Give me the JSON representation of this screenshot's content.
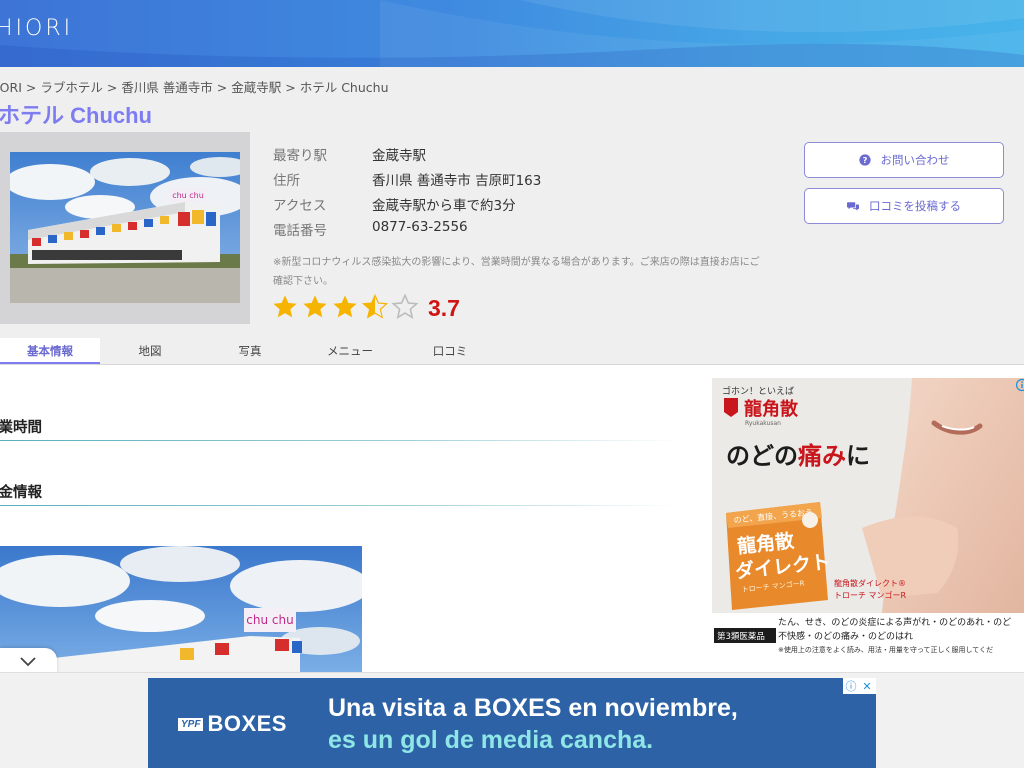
{
  "header": {
    "logo": "HIORI"
  },
  "breadcrumb": {
    "items": [
      "IORI",
      "ラブホテル",
      "香川県 善通寺市",
      "金蔵寺駅",
      "ホテル Chuchu"
    ],
    "separator": ">"
  },
  "hotel": {
    "name": "ホテル Chuchu",
    "photo_sign": "chu chu",
    "info": [
      {
        "key": "最寄り駅",
        "value": "金蔵寺駅"
      },
      {
        "key": "住所",
        "value": "香川県 善通寺市 吉原町163"
      },
      {
        "key": "アクセス",
        "value": "金蔵寺駅から車で約3分"
      },
      {
        "key": "電話番号",
        "value": "0877-63-2556"
      }
    ],
    "notice": "※新型コロナウィルス感染拡大の影響により、営業時間が異なる場合があります。ご来店の際は直接お店にご確認下さい。",
    "rating": {
      "value": 3.7,
      "label": "3.7",
      "max": 5
    }
  },
  "buttons": {
    "inquiry": "お問い合わせ",
    "review": "口コミを投稿する"
  },
  "tabs": [
    {
      "label": "基本情報",
      "active": true
    },
    {
      "label": "地図",
      "active": false
    },
    {
      "label": "写真",
      "active": false
    },
    {
      "label": "メニュー",
      "active": false
    },
    {
      "label": "口コミ",
      "active": false
    }
  ],
  "sections": [
    {
      "heading": "営業時間"
    },
    {
      "heading": "料金情報"
    }
  ],
  "side_ad": {
    "brand_tag": "ゴホン！といえば",
    "brand": "龍角散",
    "brand_en": "Ryukakusan",
    "headline_pre": "のどの",
    "headline_accent": "痛み",
    "headline_post": "に",
    "box_top": "のど、直接、うるおう",
    "box_name_1": "龍角散",
    "box_name_2": "ダイレクト",
    "box_sub": "トローチ マンゴーR",
    "product_caption_1": "龍角散ダイレクト®",
    "product_caption_2": "トローチ マンゴーR",
    "badge": "第3類医薬品",
    "claim_1": "たん、せき、のどの炎症による声がれ・のどのあれ・のど",
    "claim_2": "不快感・のどの痛み・のどのはれ",
    "claim_3": "※使用上の注意をよく読み、用法・用量を守って正しく服用してくだ"
  },
  "banner": {
    "ypf": "YPF",
    "brand": "BOXES",
    "line1": "Una visita a BOXES en noviembre,",
    "line2": "es un gol de media cancha."
  },
  "colors": {
    "accent": "#7d7cf0",
    "rating_red": "#d01414",
    "star": "#f5b400",
    "banner_blue": "#2d63a6",
    "banner_teal": "#8fe6e6"
  }
}
